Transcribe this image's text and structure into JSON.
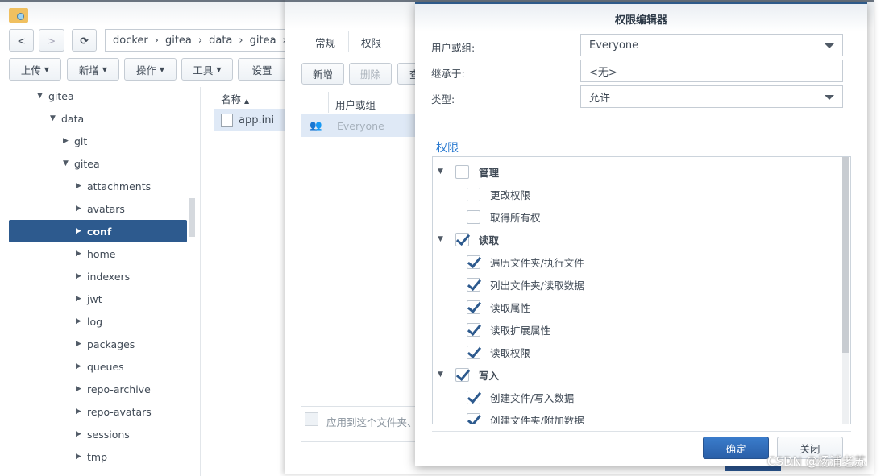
{
  "file_manager": {
    "nav": {
      "back": "<",
      "forward": ">",
      "refresh": "⟳"
    },
    "breadcrumb": [
      "docker",
      "gitea",
      "data",
      "gitea"
    ],
    "toolbar": [
      "上传",
      "新增",
      "操作",
      "工具",
      "设置"
    ],
    "tree": [
      {
        "label": "gitea",
        "level": 0,
        "expanded": true
      },
      {
        "label": "data",
        "level": 1,
        "expanded": true
      },
      {
        "label": "git",
        "level": 2,
        "expanded": false
      },
      {
        "label": "gitea",
        "level": 2,
        "expanded": true
      },
      {
        "label": "attachments",
        "level": 3
      },
      {
        "label": "avatars",
        "level": 3
      },
      {
        "label": "conf",
        "level": 3,
        "selected": true
      },
      {
        "label": "home",
        "level": 3
      },
      {
        "label": "indexers",
        "level": 3
      },
      {
        "label": "jwt",
        "level": 3
      },
      {
        "label": "log",
        "level": 3
      },
      {
        "label": "packages",
        "level": 3
      },
      {
        "label": "queues",
        "level": 3
      },
      {
        "label": "repo-archive",
        "level": 3
      },
      {
        "label": "repo-avatars",
        "level": 3
      },
      {
        "label": "sessions",
        "level": 3
      },
      {
        "label": "tmp",
        "level": 3
      }
    ],
    "column_name": "名称",
    "files": [
      "app.ini"
    ]
  },
  "properties": {
    "tabs": [
      "常规",
      "权限"
    ],
    "active_tab": "权限",
    "buttons": [
      "新增",
      "删除",
      "查"
    ],
    "column_user": "用户或组",
    "rows": [
      "Everyone"
    ],
    "apply_label": "应用到这个文件夹、子"
  },
  "dialog": {
    "title": "权限编辑器",
    "user_label": "用户或组:",
    "user_value": "Everyone",
    "inherit_label": "继承于:",
    "inherit_value": "<无>",
    "type_label": "类型:",
    "type_value": "允许",
    "section": "权限",
    "permissions": [
      {
        "label": "管理",
        "group": true,
        "checked": false
      },
      {
        "label": "更改权限",
        "checked": false
      },
      {
        "label": "取得所有权",
        "checked": false
      },
      {
        "label": "读取",
        "group": true,
        "checked": true
      },
      {
        "label": "遍历文件夹/执行文件",
        "checked": true
      },
      {
        "label": "列出文件夹/读取数据",
        "checked": true
      },
      {
        "label": "读取属性",
        "checked": true
      },
      {
        "label": "读取扩展属性",
        "checked": true
      },
      {
        "label": "读取权限",
        "checked": true
      },
      {
        "label": "写入",
        "group": true,
        "checked": true
      },
      {
        "label": "创建文件/写入数据",
        "checked": true
      },
      {
        "label": "创建文件夹/附加数据",
        "checked": true
      }
    ],
    "ok": "确定",
    "close": "关闭"
  },
  "watermark": "CSDN @杨浦老苏",
  "colors": {
    "accent": "#2d5a8e",
    "primary_button": "#2f6cb8"
  }
}
